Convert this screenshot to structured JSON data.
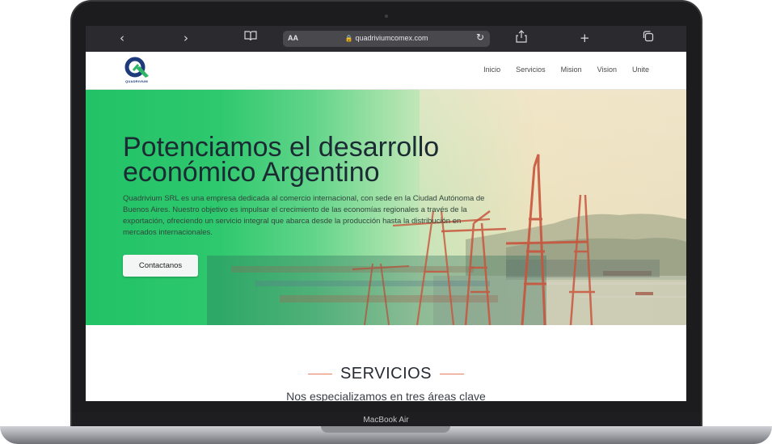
{
  "browser": {
    "back_icon": "chevron-left-icon",
    "forward_icon": "chevron-right-icon",
    "reader_label": "AA",
    "url": "quadriviumcomex.com",
    "icons": [
      "book-icon",
      "lock-icon",
      "reload-icon",
      "share-icon",
      "plus-icon",
      "tabs-icon"
    ]
  },
  "site": {
    "logo_text": "QUADRIVIUM",
    "nav": [
      "Inicio",
      "Servicios",
      "Mision",
      "Vision",
      "Unite"
    ]
  },
  "hero": {
    "title_line1": "Potenciamos el desarrollo",
    "title_line2": "económico Argentino",
    "description": "Quadrivium SRL es una empresa dedicada al comercio internacional, con sede en la Ciudad Autónoma de Buenos Aires. Nuestro objetivo es impulsar el crecimiento de las economías regionales a través de la exportación, ofreciendo un servicio integral que abarca desde la producción hasta la distribución en mercados internacionales.",
    "cta": "Contactanos"
  },
  "services": {
    "title": "SERVICIOS",
    "subtitle": "Nos especializamos en tres áreas clave"
  },
  "device": {
    "model": "MacBook Air"
  },
  "colors": {
    "brand_green": "#22c267",
    "accent_line": "#e87e5a",
    "crane_red": "#c8553d"
  }
}
